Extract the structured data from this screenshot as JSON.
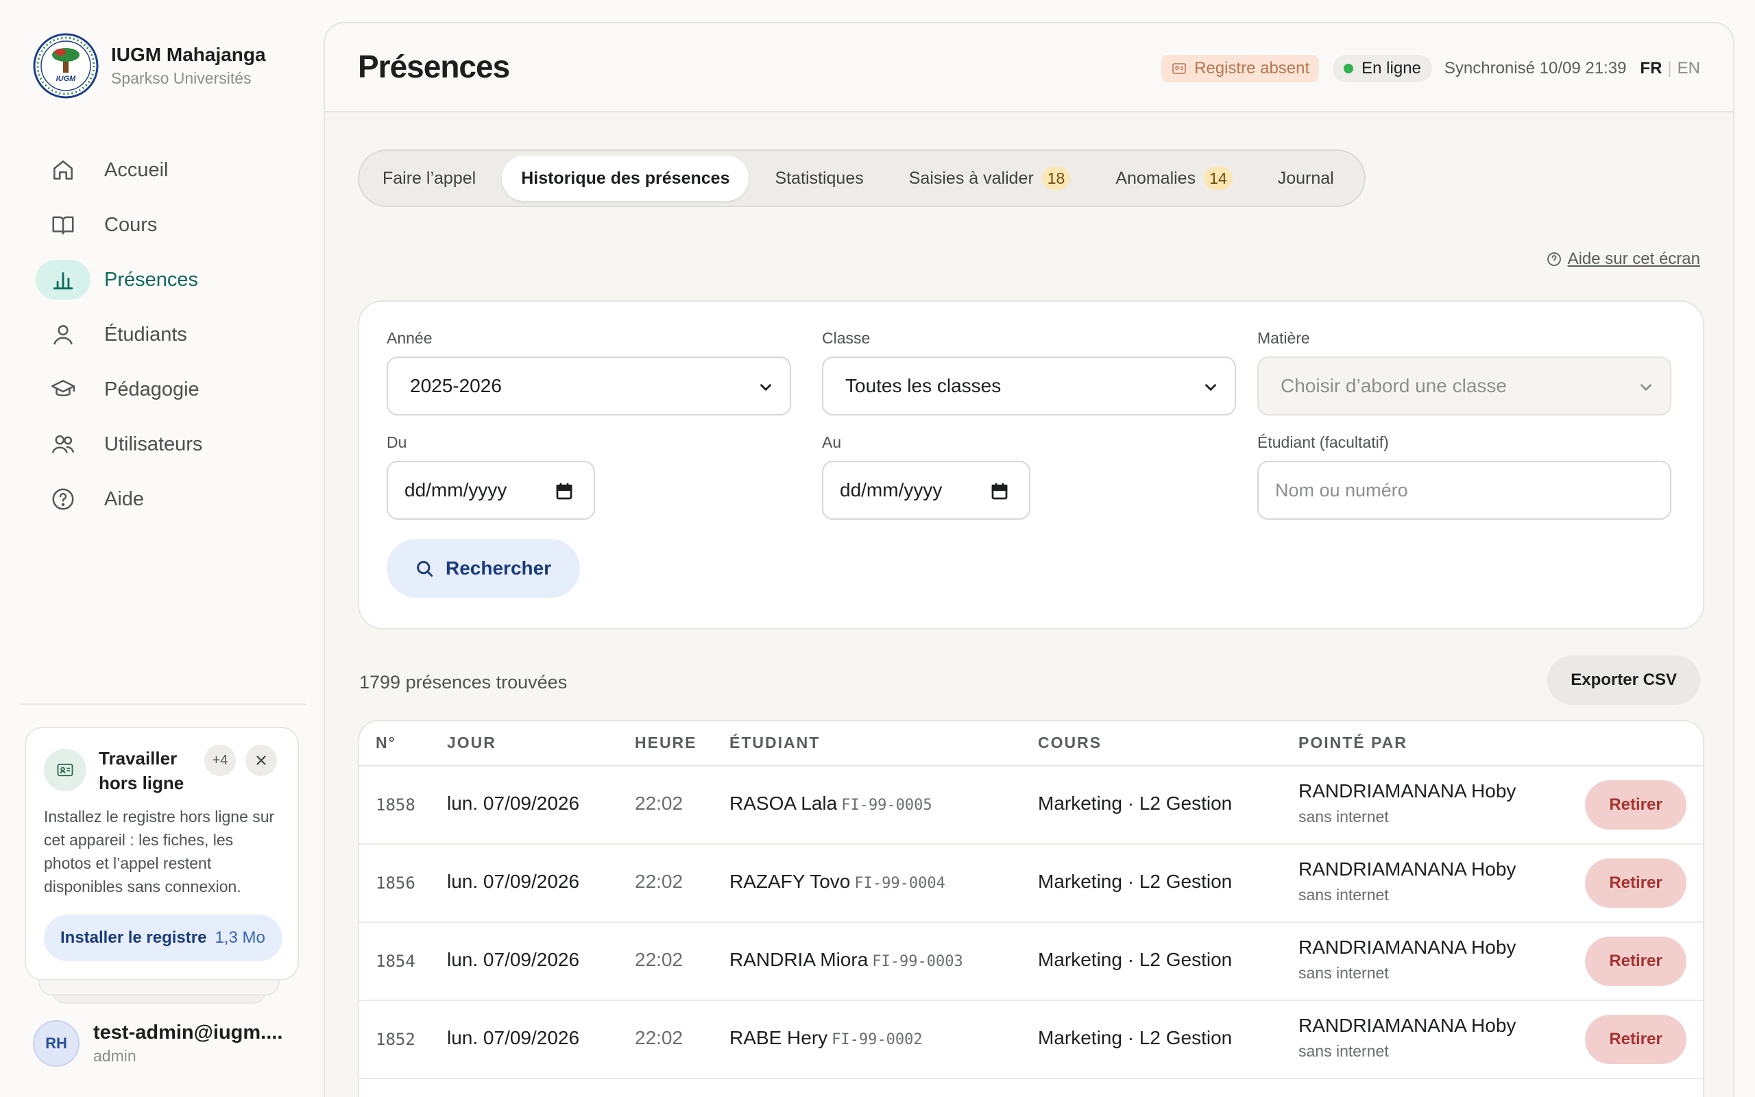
{
  "brand": {
    "title": "IUGM Mahajanga",
    "subtitle": "Sparkso Universités"
  },
  "nav": {
    "items": [
      {
        "label": "Accueil",
        "icon": "home-icon"
      },
      {
        "label": "Cours",
        "icon": "book-icon"
      },
      {
        "label": "Présences",
        "icon": "bar-chart-icon",
        "active": true
      },
      {
        "label": "Étudiants",
        "icon": "user-icon"
      },
      {
        "label": "Pédagogie",
        "icon": "graduation-cap-icon"
      },
      {
        "label": "Utilisateurs",
        "icon": "users-icon"
      },
      {
        "label": "Aide",
        "icon": "help-circle-icon"
      }
    ]
  },
  "offline_card": {
    "title": "Travailler hors ligne",
    "badge": "+4",
    "body": "Installez le registre hors ligne sur cet appareil : les fiches, les photos et l’appel restent disponibles sans connexion.",
    "install_label": "Installer le registre",
    "install_size": "1,3 Mo"
  },
  "user": {
    "initials": "RH",
    "email": "test-admin@iugm....",
    "role": "admin"
  },
  "header": {
    "title": "Présences",
    "register_status": "Registre absent",
    "online_status": "En ligne",
    "sync": "Synchronisé 10/09 21:39",
    "lang_fr": "FR",
    "lang_sep": "|",
    "lang_en": "EN"
  },
  "tabs": [
    {
      "label": "Faire l’appel"
    },
    {
      "label": "Historique des présences",
      "active": true
    },
    {
      "label": "Statistiques"
    },
    {
      "label": "Saisies à valider",
      "count": "18"
    },
    {
      "label": "Anomalies",
      "count": "14"
    },
    {
      "label": "Journal"
    }
  ],
  "help_link": "Aide sur cet écran",
  "filters": {
    "year_label": "Année",
    "year_value": "2025-2026",
    "class_label": "Classe",
    "class_value": "Toutes les classes",
    "subject_label": "Matière",
    "subject_placeholder": "Choisir d’abord une classe",
    "from_label": "Du",
    "from_value": "dd/mm/yyyy",
    "to_label": "Au",
    "to_value": "dd/mm/yyyy",
    "student_label": "Étudiant (facultatif)",
    "student_placeholder": "Nom ou numéro",
    "search_button": "Rechercher"
  },
  "results": {
    "count_text": "1799 présences trouvées",
    "export_button": "Exporter CSV"
  },
  "table": {
    "headers": {
      "num": "N°",
      "day": "JOUR",
      "time": "HEURE",
      "student": "ÉTUDIANT",
      "course": "COURS",
      "by": "POINTÉ PAR"
    },
    "action_label": "Retirer",
    "rows": [
      {
        "num": "1858",
        "day": "lun. 07/09/2026",
        "time": "22:02",
        "student": "RASOA Lala",
        "matricule": "FI-99-0005",
        "course": "Marketing · L2 Gestion",
        "by": "RANDRIAMANANA Hoby",
        "by_note": "sans internet"
      },
      {
        "num": "1856",
        "day": "lun. 07/09/2026",
        "time": "22:02",
        "student": "RAZAFY Tovo",
        "matricule": "FI-99-0004",
        "course": "Marketing · L2 Gestion",
        "by": "RANDRIAMANANA Hoby",
        "by_note": "sans internet"
      },
      {
        "num": "1854",
        "day": "lun. 07/09/2026",
        "time": "22:02",
        "student": "RANDRIA Miora",
        "matricule": "FI-99-0003",
        "course": "Marketing · L2 Gestion",
        "by": "RANDRIAMANANA Hoby",
        "by_note": "sans internet"
      },
      {
        "num": "1852",
        "day": "lun. 07/09/2026",
        "time": "22:02",
        "student": "RABE Hery",
        "matricule": "FI-99-0002",
        "course": "Marketing · L2 Gestion",
        "by": "RANDRIAMANANA Hoby",
        "by_note": "sans internet"
      }
    ]
  }
}
